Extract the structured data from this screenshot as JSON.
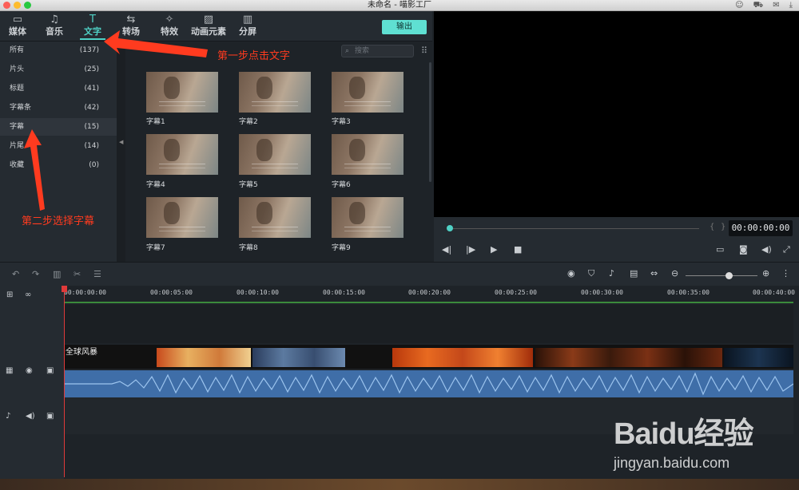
{
  "window": {
    "title": "未命名 - 喵影工厂"
  },
  "top_icons": [
    "user-icon",
    "cart-icon",
    "mail-icon",
    "download-icon"
  ],
  "tabs": [
    {
      "label": "媒体",
      "icon": "folder-icon"
    },
    {
      "label": "音乐",
      "icon": "music-icon"
    },
    {
      "label": "文字",
      "icon": "text-icon"
    },
    {
      "label": "转场",
      "icon": "transition-icon"
    },
    {
      "label": "特效",
      "icon": "effects-icon"
    },
    {
      "label": "动画元素",
      "icon": "image-icon"
    },
    {
      "label": "分屏",
      "icon": "split-screen-icon"
    }
  ],
  "export_label": "输出",
  "categories": [
    {
      "name": "所有",
      "count": "(137)"
    },
    {
      "name": "片头",
      "count": "(25)"
    },
    {
      "name": "标题",
      "count": "(41)"
    },
    {
      "name": "字幕条",
      "count": "(42)"
    },
    {
      "name": "字幕",
      "count": "(15)"
    },
    {
      "name": "片尾",
      "count": "(14)"
    },
    {
      "name": "收藏",
      "count": "(0)"
    }
  ],
  "search": {
    "placeholder": "搜索"
  },
  "thumbnails": [
    "字幕1",
    "字幕2",
    "字幕3",
    "字幕4",
    "字幕5",
    "字幕6",
    "字幕7",
    "字幕8",
    "字幕9"
  ],
  "annotations": {
    "step1": "第一步点击文字",
    "step2": "第二步选择字幕"
  },
  "player": {
    "timecode": "00:00:00:00"
  },
  "ruler": [
    "00:00:00:00",
    "00:00:05:00",
    "00:00:10:00",
    "00:00:15:00",
    "00:00:20:00",
    "00:00:25:00",
    "00:00:30:00",
    "00:00:35:00",
    "00:00:40:00"
  ],
  "clip": {
    "title": "全球风暴"
  },
  "watermark": {
    "brand": "Baidu经验",
    "url": "jingyan.baidu.com"
  },
  "colors": {
    "accent": "#4fd1c5",
    "annotation": "#ff3b1f",
    "playhead": "#e03a3a",
    "audio_clip": "#3f6ea8"
  }
}
